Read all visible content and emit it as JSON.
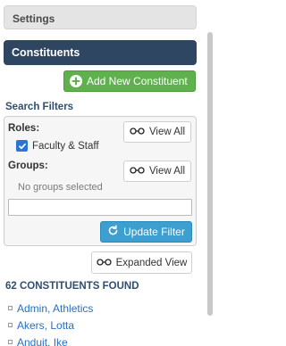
{
  "sidebar": {
    "settings_label": "Settings",
    "constituents_label": "Constituents",
    "add_button_label": "Add New Constituent",
    "search_filters_label": "Search Filters"
  },
  "filters": {
    "roles_label": "Roles:",
    "role_checkbox_label": "Faculty & Staff",
    "role_checked": true,
    "view_all_label": "View All",
    "groups_label": "Groups:",
    "no_groups_text": "No groups selected",
    "filter_input_value": "",
    "update_button_label": "Update Filter"
  },
  "view": {
    "expanded_view_label": "Expanded View"
  },
  "results": {
    "count_text": "62 CONSTITUENTS FOUND",
    "items": [
      {
        "name": "Admin, Athletics"
      },
      {
        "name": "Akers, Lotta"
      },
      {
        "name": "Anduit, Ike"
      }
    ]
  },
  "colors": {
    "header_dark": "#2f4663",
    "add_green": "#5fb14e",
    "update_blue": "#3d9ed0",
    "link_blue": "#2a6fbf",
    "section_label": "#2f4f6f"
  },
  "icons": {
    "add": "plus-circle-icon",
    "view": "glasses-icon",
    "update": "refresh-icon",
    "bullet": "square-bullet-icon"
  }
}
